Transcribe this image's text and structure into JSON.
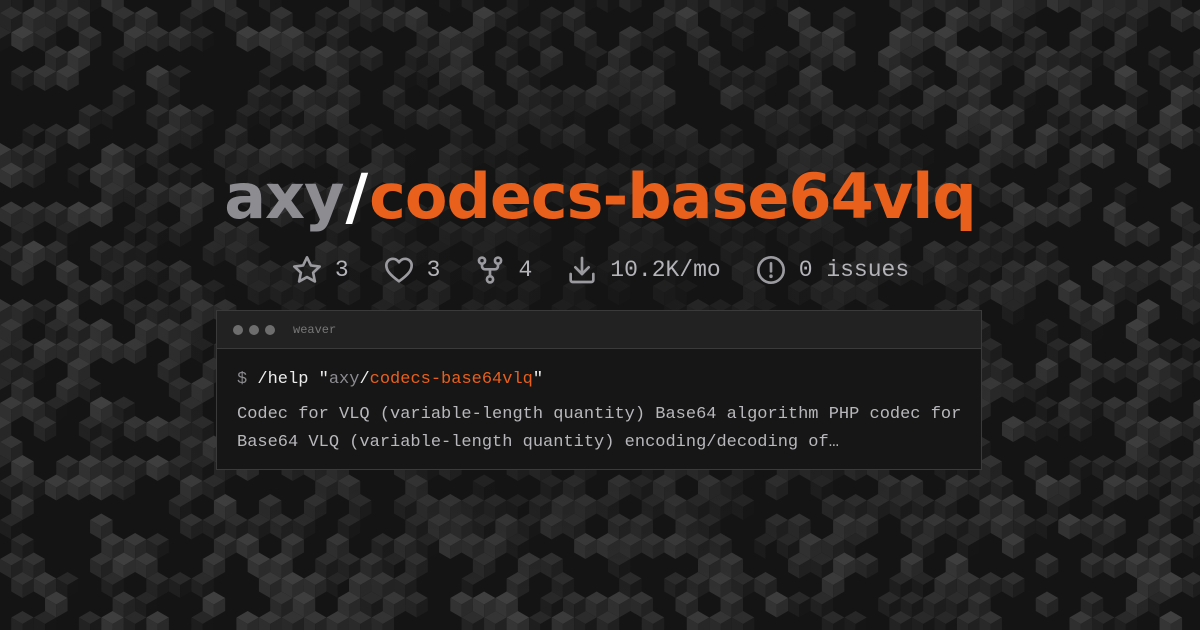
{
  "title": {
    "owner": "axy",
    "separator": "/",
    "package": "codecs-base64vlq"
  },
  "stats": [
    {
      "icon": "star-icon",
      "value": "3"
    },
    {
      "icon": "heart-icon",
      "value": "3"
    },
    {
      "icon": "fork-icon",
      "value": "4"
    },
    {
      "icon": "download-icon",
      "value": "10.2K/mo"
    },
    {
      "icon": "alert-circle-icon",
      "value": "0 issues"
    }
  ],
  "terminal": {
    "window_title": "weaver",
    "prompt": "$",
    "command": "/help",
    "quote_open": "\"",
    "arg_owner": "axy",
    "arg_slash": "/",
    "arg_package": "codecs-base64vlq",
    "quote_close": "\"",
    "description": "Codec for VLQ (variable-length quantity) Base64 algorithm PHP codec for Base64 VLQ (variable-length quantity) encoding/decoding of…"
  },
  "colors": {
    "accent": "#e8601c",
    "owner": "#8c8c91",
    "background": "#141414"
  }
}
